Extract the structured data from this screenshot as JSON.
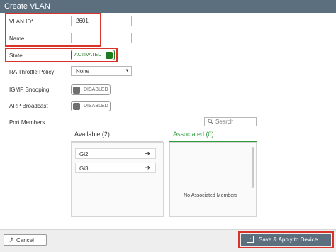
{
  "window": {
    "title": "Create VLAN"
  },
  "form": {
    "vlan_id_label": "VLAN ID*",
    "vlan_id_value": "2601",
    "name_label": "Name",
    "name_value": "",
    "state_label": "State",
    "state_value": "ACTIVATED",
    "ra_throttle_label": "RA Throttle Policy",
    "ra_throttle_value": "None",
    "igmp_label": "IGMP Snooping",
    "igmp_value": "DISABLED",
    "arp_label": "ARP Broadcast",
    "arp_value": "DISABLED",
    "port_members_label": "Port Members",
    "search_placeholder": "Search"
  },
  "ports": {
    "available_title": "Available (2)",
    "associated_title": "Associated (0)",
    "available": [
      "Gi2",
      "Gi3"
    ],
    "associated_empty": "No Associated Members"
  },
  "footer": {
    "cancel_label": "Cancel",
    "apply_label": "Save & Apply to Device"
  },
  "colors": {
    "title_bar": "#5c6f7e",
    "highlight": "#d9342b",
    "activated": "#1e7a1e",
    "associated_accent": "#2f9d3a"
  },
  "icons": [
    "undo-icon",
    "search-icon",
    "arrow-right-icon",
    "save-icon",
    "chevron-down-icon"
  ]
}
